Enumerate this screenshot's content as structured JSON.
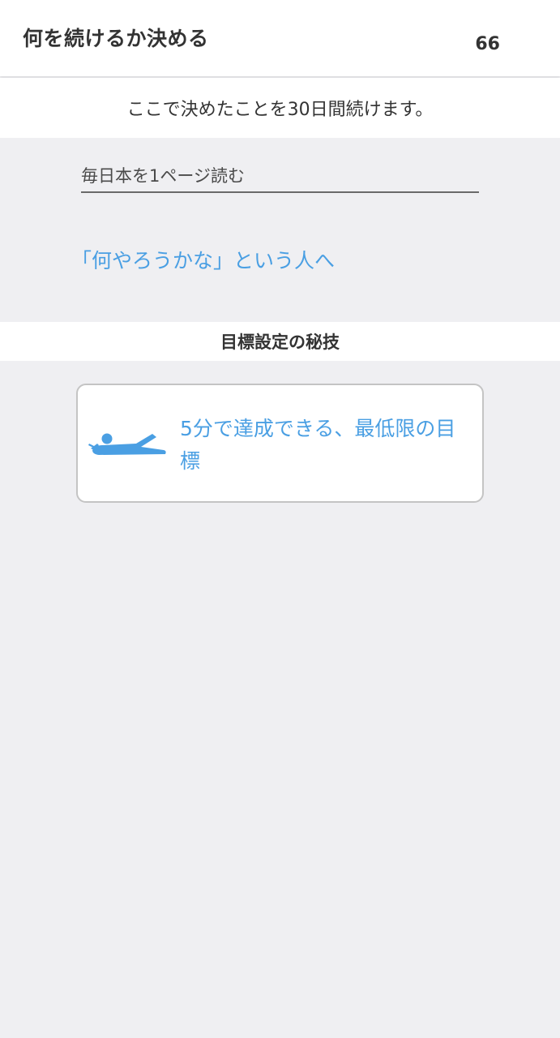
{
  "header": {
    "title": "何を続けるか決める",
    "count": "66"
  },
  "subtitle": "ここで決めたことを30日間続けます。",
  "goal_input": {
    "placeholder": "毎日本を1ページ読む",
    "value": ""
  },
  "help_link": "「何やろうかな」という人へ",
  "section": {
    "title": "目標設定の秘技"
  },
  "tip_card": {
    "icon": "lying-reading-person-icon",
    "text": "5分で達成できる、最低限の目標"
  },
  "colors": {
    "background": "#efeff2",
    "accent": "#4a9fe3",
    "text": "#333333",
    "card_border": "#c4c4c4"
  }
}
